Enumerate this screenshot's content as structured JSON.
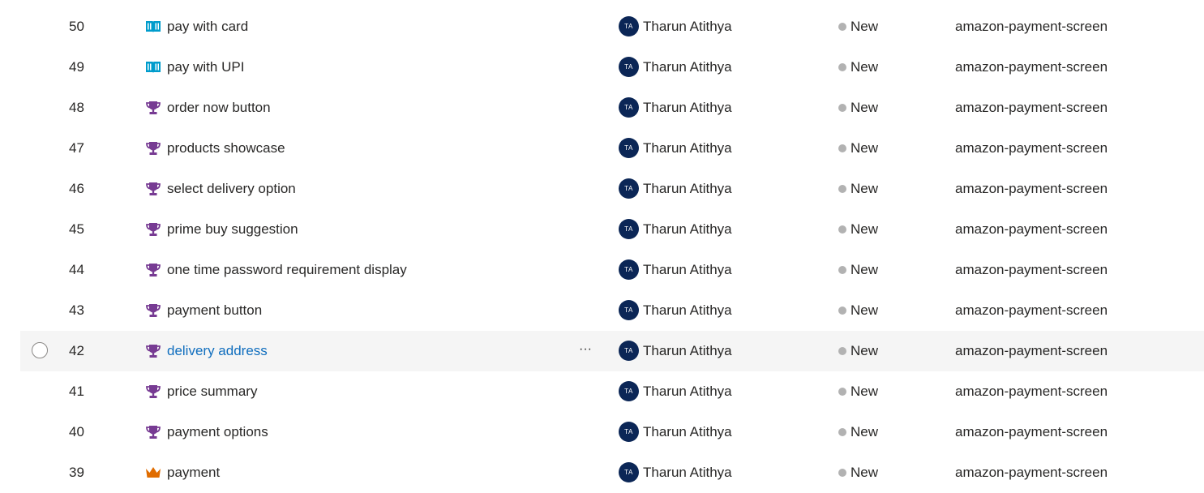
{
  "colors": {
    "avatar_bg": "#0b2656",
    "state_dot": "#b2b2b2",
    "user_story_icon": "#009ccc",
    "feature_icon": "#773b93",
    "epic_icon": "#e06c00",
    "link_hover": "#106ebe",
    "hover_row_bg": "#f5f5f5"
  },
  "rows": [
    {
      "id": "50",
      "icon": "book-icon",
      "title": "pay with card",
      "assignee_initials": "TA",
      "assignee": "Tharun Atithya",
      "state": "New",
      "area": "amazon-payment-screen"
    },
    {
      "id": "49",
      "icon": "book-icon",
      "title": "pay with UPI",
      "assignee_initials": "TA",
      "assignee": "Tharun Atithya",
      "state": "New",
      "area": "amazon-payment-screen"
    },
    {
      "id": "48",
      "icon": "trophy-icon",
      "title": "order now button",
      "assignee_initials": "TA",
      "assignee": "Tharun Atithya",
      "state": "New",
      "area": "amazon-payment-screen"
    },
    {
      "id": "47",
      "icon": "trophy-icon",
      "title": "products showcase",
      "assignee_initials": "TA",
      "assignee": "Tharun Atithya",
      "state": "New",
      "area": "amazon-payment-screen"
    },
    {
      "id": "46",
      "icon": "trophy-icon",
      "title": "select delivery option",
      "assignee_initials": "TA",
      "assignee": "Tharun Atithya",
      "state": "New",
      "area": "amazon-payment-screen"
    },
    {
      "id": "45",
      "icon": "trophy-icon",
      "title": "prime buy suggestion",
      "assignee_initials": "TA",
      "assignee": "Tharun Atithya",
      "state": "New",
      "area": "amazon-payment-screen"
    },
    {
      "id": "44",
      "icon": "trophy-icon",
      "title": "one time password requirement display",
      "assignee_initials": "TA",
      "assignee": "Tharun Atithya",
      "state": "New",
      "area": "amazon-payment-screen"
    },
    {
      "id": "43",
      "icon": "trophy-icon",
      "title": "payment button",
      "assignee_initials": "TA",
      "assignee": "Tharun Atithya",
      "state": "New",
      "area": "amazon-payment-screen"
    },
    {
      "id": "42",
      "icon": "trophy-icon",
      "title": "delivery address",
      "assignee_initials": "TA",
      "assignee": "Tharun Atithya",
      "state": "New",
      "area": "amazon-payment-screen",
      "hovered": true,
      "more_label": "···"
    },
    {
      "id": "41",
      "icon": "trophy-icon",
      "title": "price summary",
      "assignee_initials": "TA",
      "assignee": "Tharun Atithya",
      "state": "New",
      "area": "amazon-payment-screen"
    },
    {
      "id": "40",
      "icon": "trophy-icon",
      "title": "payment options",
      "assignee_initials": "TA",
      "assignee": "Tharun Atithya",
      "state": "New",
      "area": "amazon-payment-screen"
    },
    {
      "id": "39",
      "icon": "crown-icon",
      "title": "payment",
      "assignee_initials": "TA",
      "assignee": "Tharun Atithya",
      "state": "New",
      "area": "amazon-payment-screen"
    }
  ]
}
